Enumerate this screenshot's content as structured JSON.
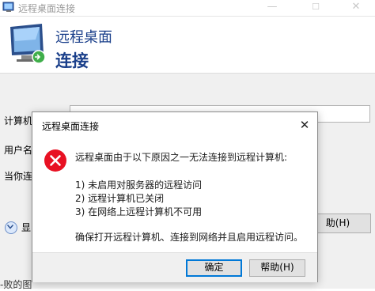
{
  "parent": {
    "title": "远程桌面连接",
    "banner_line1": "远程桌面",
    "banner_line2": "连接",
    "label_computer": "计算机",
    "label_username": "用户名",
    "label_connect": "当你连",
    "show_options": "显",
    "help_button": "助(H)",
    "bottom_fragment": "-败的图"
  },
  "dialog": {
    "title": "远程桌面连接",
    "message_lines": [
      "远程桌面由于以下原因之一无法连接到远程计算机:",
      "1) 未启用对服务器的远程访问",
      "2) 远程计算机已关闭",
      "3) 在网络上远程计算机不可用",
      "确保打开远程计算机、连接到网络并且启用远程访问。"
    ],
    "ok_button": "确定",
    "help_button": "帮助(H)"
  },
  "icons": {
    "parent_app": "remote-desktop-icon",
    "banner": "monitor-icon",
    "error": "error-icon",
    "show_options": "chevron-down-icon"
  },
  "colors": {
    "accent": "#0078d7",
    "banner_text": "#1a3f8a",
    "error_red": "#e81123"
  }
}
